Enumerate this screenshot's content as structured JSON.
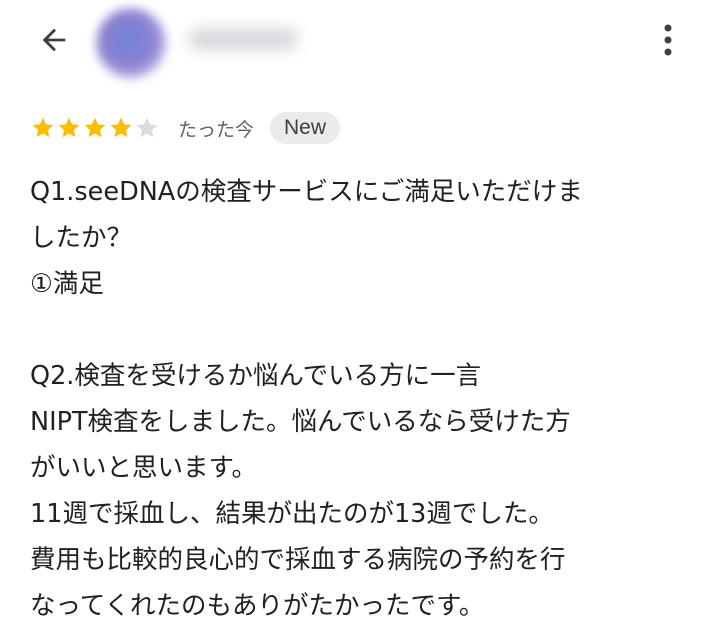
{
  "header": {
    "back_icon": "arrow-back-icon",
    "more_icon": "more-vert-icon"
  },
  "review": {
    "rating": 4,
    "max_rating": 5,
    "star_color": "#fbbc04",
    "star_empty_color": "#dadce0",
    "time": "たった今",
    "badge": "New",
    "lines": [
      "Q1.seeDNAの検査サービスにご満足いただけま",
      "したか？",
      "①満足",
      "",
      "Q2.検査を受けるか悩んでいる方に一言",
      "NIPT検査をしました。悩んでいるなら受けた方",
      "がいいと思います。",
      "11週で採血し、結果が出たのが13週でした。",
      "費用も比較的良心的で採血する病院の予約を行",
      "なってくれたのもありがたかったです。"
    ]
  }
}
